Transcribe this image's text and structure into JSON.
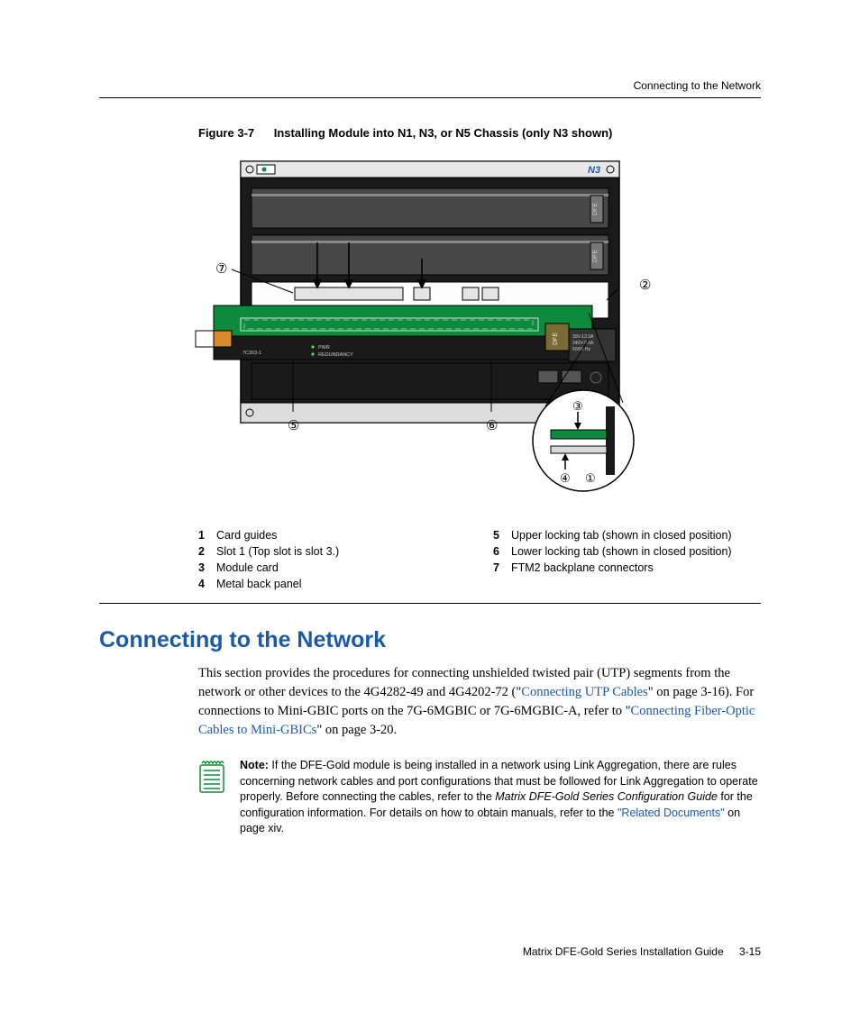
{
  "running_head": "Connecting to the Network",
  "figure": {
    "label": "Figure 3-7",
    "title": "Installing Module into N1, N3, or N5 Chassis (only N3 shown)",
    "chassis_label": "N3",
    "psu": {
      "line1": "30V-12.0A",
      "line2": "240V-9.0A",
      "line3": "50/60 Hz"
    },
    "led_pwr": "PWR",
    "led_red": "REDUNDANCY",
    "card_model": "7C303-1",
    "dfe_label": "DFE"
  },
  "callouts": {
    "c1": "①",
    "c2": "②",
    "c3": "③",
    "c4": "④",
    "c5": "⑤",
    "c6": "⑥",
    "c7": "⑦"
  },
  "legend": {
    "l1_num": "1",
    "l1_txt": "Card guides",
    "l2_num": "2",
    "l2_txt": "Slot 1 (Top slot is slot 3.)",
    "l3_num": "3",
    "l3_txt": "Module card",
    "l4_num": "4",
    "l4_txt": "Metal back panel",
    "l5_num": "5",
    "l5_txt": "Upper locking tab (shown in closed position)",
    "l6_num": "6",
    "l6_txt": "Lower locking tab (shown in closed position)",
    "l7_num": "7",
    "l7_txt": "FTM2 backplane connectors"
  },
  "section_heading": "Connecting to the Network",
  "para": {
    "t1": "This section provides the procedures for connecting unshielded twisted pair (UTP) segments from the network or other devices to the 4G4282-49 and 4G4202-72 (\"",
    "link1": "Connecting UTP Cables",
    "t2": "\" on page 3-16). For connections to Mini-GBIC ports on the 7G-6MGBIC or 7G-6MGBIC-A, refer to \"",
    "link2": "Connecting Fiber-Optic Cables to Mini-GBICs",
    "t3": "\" on page 3-20."
  },
  "note": {
    "label": "Note: ",
    "t1": "If the DFE-Gold module is being installed in a network using Link Aggregation, there are rules concerning network cables and port configurations that must be followed for Link Aggregation to operate properly. Before connecting the cables, refer to the ",
    "ital": "Matrix DFE-Gold Series Configuration Guide",
    "t2": " for the configuration information. For details on how to obtain manuals, refer to the ",
    "link": "\"Related Documents\"",
    "t3": "  on page xiv."
  },
  "footer": {
    "doc": "Matrix DFE-Gold Series Installation Guide",
    "page": "3-15"
  }
}
